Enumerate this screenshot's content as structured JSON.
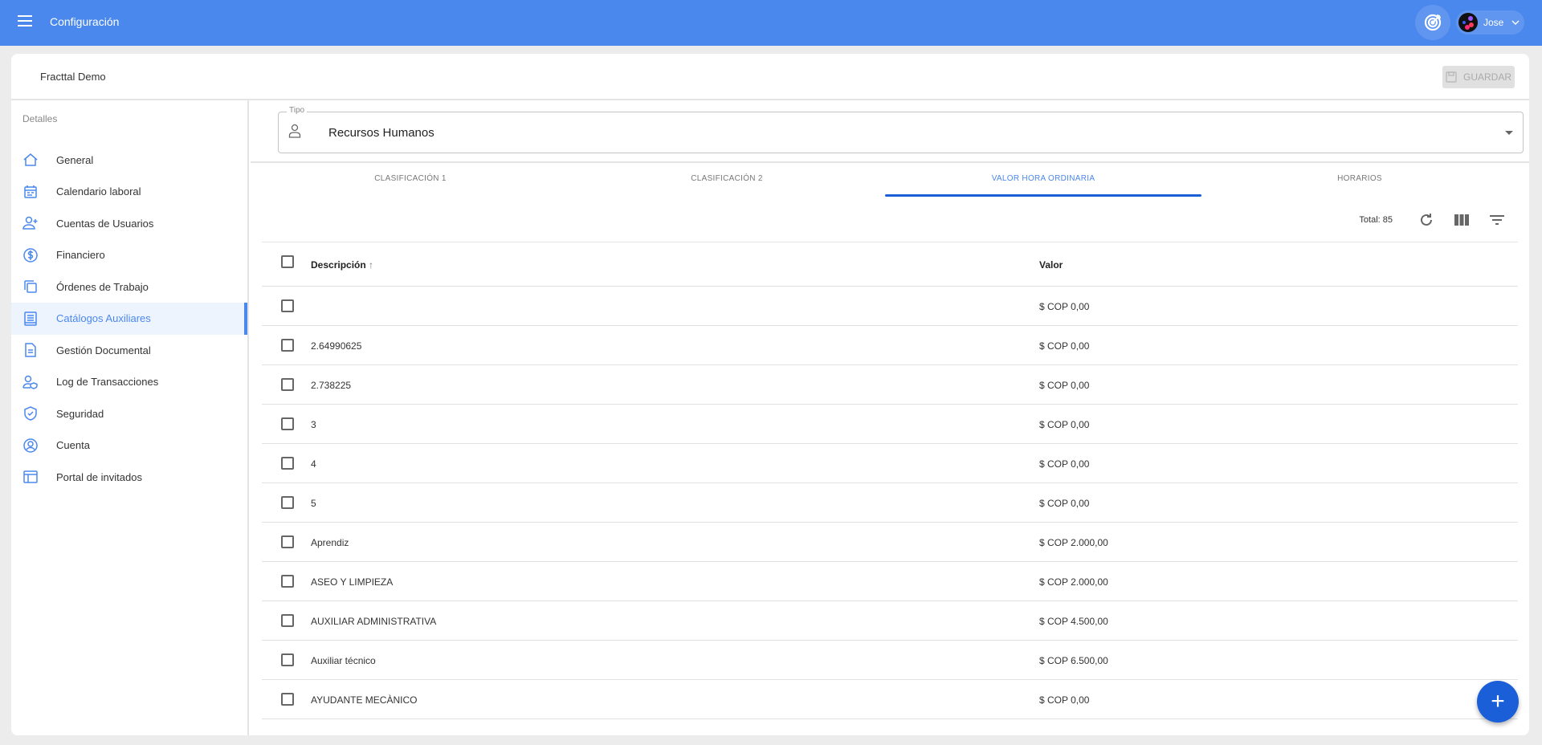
{
  "header": {
    "title": "Configuración",
    "user_name": "Jose"
  },
  "company": "Fracttal Demo",
  "save_label": "GUARDAR",
  "sidebar": {
    "section_label": "Detalles",
    "active_index": 5,
    "items": [
      {
        "label": "General",
        "icon": "home-icon"
      },
      {
        "label": "Calendario laboral",
        "icon": "calendar-icon"
      },
      {
        "label": "Cuentas de Usuarios",
        "icon": "user-add-icon"
      },
      {
        "label": "Financiero",
        "icon": "dollar-icon"
      },
      {
        "label": "Órdenes de Trabajo",
        "icon": "copy-icon"
      },
      {
        "label": "Catálogos Auxiliares",
        "icon": "book-icon"
      },
      {
        "label": "Gestión Documental",
        "icon": "document-icon"
      },
      {
        "label": "Log de Transacciones",
        "icon": "user-shield-icon"
      },
      {
        "label": "Seguridad",
        "icon": "shield-check-icon"
      },
      {
        "label": "Cuenta",
        "icon": "account-circle-icon"
      },
      {
        "label": "Portal de invitados",
        "icon": "layout-icon"
      }
    ]
  },
  "tipo": {
    "label": "Tipo",
    "value": "Recursos Humanos"
  },
  "tabs": [
    {
      "label": "CLASIFICACIÓN 1"
    },
    {
      "label": "CLASIFICACIÓN 2"
    },
    {
      "label": "VALOR HORA ORDINARIA",
      "active": true
    },
    {
      "label": "HORARIOS"
    }
  ],
  "toolbar": {
    "total": "Total: 85"
  },
  "table": {
    "columns": [
      "Descripción",
      "Valor"
    ],
    "rows": [
      {
        "descripcion": "",
        "valor": "$ COP 0,00"
      },
      {
        "descripcion": "2.64990625",
        "valor": "$ COP 0,00"
      },
      {
        "descripcion": "2.738225",
        "valor": "$ COP 0,00"
      },
      {
        "descripcion": "3",
        "valor": "$ COP 0,00"
      },
      {
        "descripcion": "4",
        "valor": "$ COP 0,00"
      },
      {
        "descripcion": "5",
        "valor": "$ COP 0,00"
      },
      {
        "descripcion": "Aprendiz",
        "valor": "$ COP 2.000,00"
      },
      {
        "descripcion": "ASEO Y LIMPIEZA",
        "valor": "$ COP 2.000,00"
      },
      {
        "descripcion": "AUXILIAR ADMINISTRATIVA",
        "valor": "$ COP 4.500,00"
      },
      {
        "descripcion": "Auxiliar técnico",
        "valor": "$ COP 6.500,00"
      },
      {
        "descripcion": "AYUDANTE MECÀNICO",
        "valor": "$ COP 0,00"
      }
    ]
  },
  "colors": {
    "primary": "#4a88ee",
    "accent": "#1a5fd8"
  }
}
